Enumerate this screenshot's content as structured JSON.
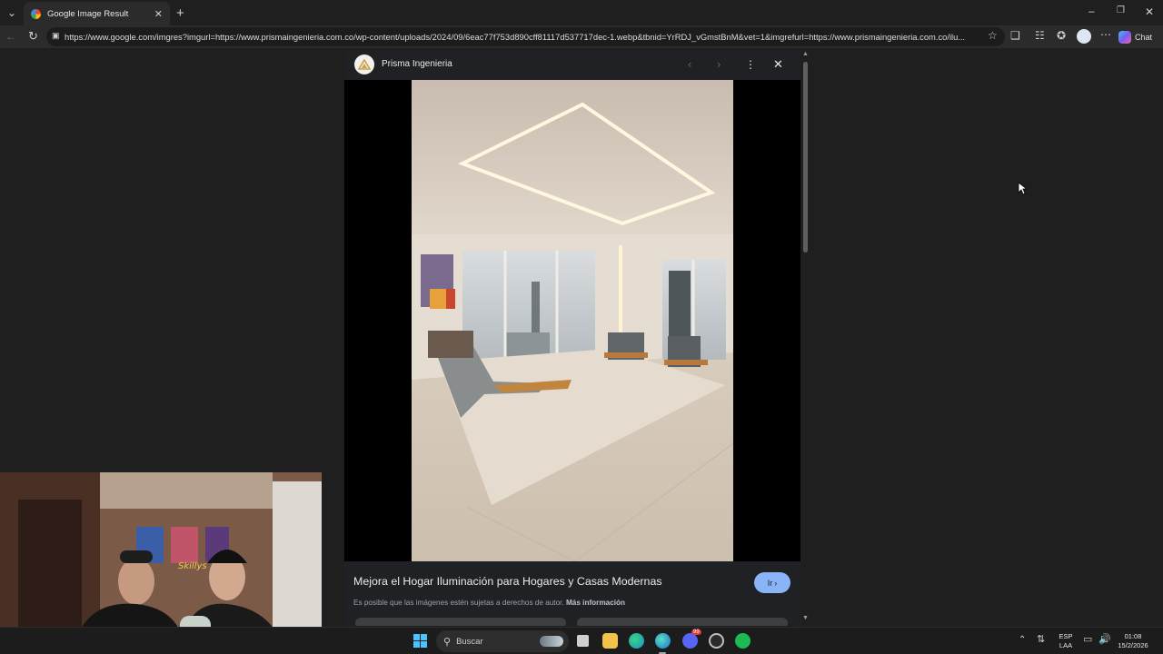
{
  "browser": {
    "tab_title": "Google Image Result",
    "url": "https://www.google.com/imgres?imgurl=https://www.prismaingenieria.com.co/wp-content/uploads/2024/09/6eac77f753d890cff81117d537717dec-1.webp&tbnid=YrRDJ_vGmstBnM&vet=1&imgrefurl=https://www.prismaingenieria.com.co/ilu...",
    "chat_label": "Chat",
    "icons": [
      "tab-list-icon",
      "new-tab-icon",
      "minimize-icon",
      "restore-icon",
      "close-icon",
      "back-icon",
      "reload-icon",
      "site-info-icon",
      "favorite-star-icon",
      "extensions-icon",
      "sidebar-icon",
      "favorites-icon",
      "profile-icon",
      "more-icon",
      "copilot-icon"
    ]
  },
  "viewer": {
    "site_name": "Prisma Ingenieria",
    "image_title": "Mejora el Hogar Iluminación para Hogares y Casas Modernas",
    "visit_label": "Ir",
    "copyright_text": "Es posible que las imágenes estén sujetas a derechos de autor.",
    "more_info_label": "Más información",
    "icons": [
      "prev-arrow-icon",
      "next-arrow-icon",
      "more-options-icon",
      "close-icon",
      "lens-search-icon"
    ]
  },
  "taskbar": {
    "search_placeholder": "Buscar",
    "lang_top": "ESP",
    "lang_bottom": "LAA",
    "time": "01:08",
    "date": "15/2/2026",
    "badge_count": "99",
    "icons": [
      "windows-start-icon",
      "search-icon",
      "task-view-icon",
      "file-explorer-icon",
      "edge-icon",
      "edge-dev-icon",
      "discord-icon",
      "github-icon",
      "spotify-icon",
      "chevron-up-icon",
      "network-icon",
      "volume-icon"
    ]
  },
  "colors": {
    "accent": "#8ab4f8",
    "background": "#1f1f1f",
    "viewer_bg": "#202124"
  }
}
